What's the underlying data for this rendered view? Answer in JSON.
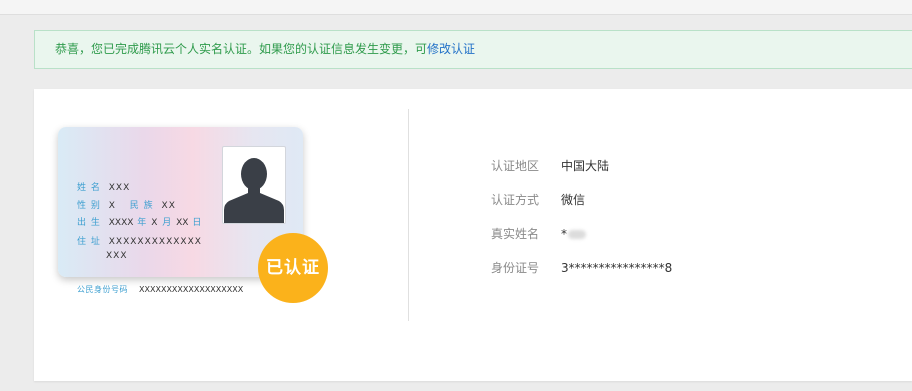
{
  "notice": {
    "message": "恭喜，您已完成腾讯云个人实名认证。如果您的认证信息发生变更，可",
    "link_label": "修改认证"
  },
  "id_card": {
    "name_label": "姓 名",
    "name_value": "XXX",
    "gender_label": "性 别",
    "gender_value": "X",
    "ethnicity_label": "民 族",
    "ethnicity_value": "XX",
    "birth_label": "出 生",
    "birth_year": "XXXX",
    "year_unit": "年",
    "birth_month": "X",
    "month_unit": "月",
    "birth_day": "XX",
    "day_unit": "日",
    "address_label": "住 址",
    "address_line1": "XXXXXXXXXXXXX",
    "address_line2": "XXX",
    "id_number_label": "公民身份号码",
    "id_number_value": "XXXXXXXXXXXXXXXXXXX"
  },
  "badge": {
    "label": "已认证",
    "color": "#fbb21b"
  },
  "details": {
    "region_label": "认证地区",
    "region_value": "中国大陆",
    "method_label": "认证方式",
    "method_value": "微信",
    "name_label": "真实姓名",
    "name_value": "*",
    "id_label": "身份证号",
    "id_value": "3****************8"
  },
  "colors": {
    "notice_text": "#2f9b4c",
    "link": "#2472c8",
    "card_label": "#3d9fd0",
    "accent": "#fbb21b"
  }
}
